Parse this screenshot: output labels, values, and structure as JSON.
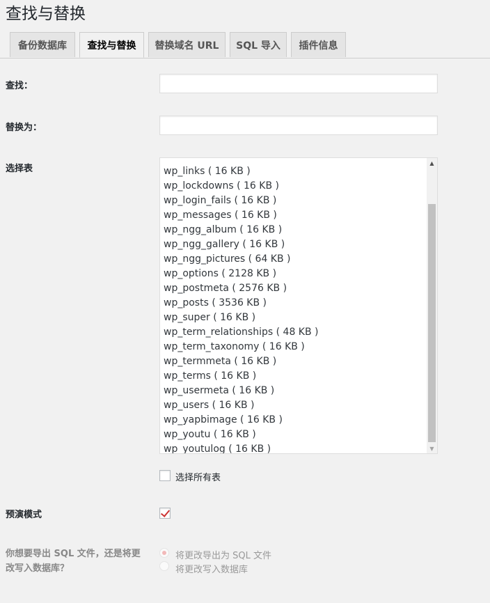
{
  "page": {
    "title": "查找与替换"
  },
  "tabs": [
    {
      "label": "备份数据库"
    },
    {
      "label": "查找与替换"
    },
    {
      "label": "替换域名 URL"
    },
    {
      "label": "SQL 导入"
    },
    {
      "label": "插件信息"
    }
  ],
  "form": {
    "find_label": "查找：",
    "replace_label": "替换为：",
    "select_tables_label": "选择表",
    "tables": [
      "wp_links ( 16 KB )",
      "wp_lockdowns ( 16 KB )",
      "wp_login_fails ( 16 KB )",
      "wp_messages ( 16 KB )",
      "wp_ngg_album ( 16 KB )",
      "wp_ngg_gallery ( 16 KB )",
      "wp_ngg_pictures ( 64 KB )",
      "wp_options ( 2128 KB )",
      "wp_postmeta ( 2576 KB )",
      "wp_posts ( 3536 KB )",
      "wp_super ( 16 KB )",
      "wp_term_relationships ( 48 KB )",
      "wp_term_taxonomy ( 16 KB )",
      "wp_termmeta ( 16 KB )",
      "wp_terms ( 16 KB )",
      "wp_usermeta ( 16 KB )",
      "wp_users ( 16 KB )",
      "wp_yapbimage ( 16 KB )",
      "wp_youtu ( 16 KB )",
      "wp_youtulog ( 16 KB )"
    ],
    "select_all_label": "选择所有表",
    "select_all_checked": false,
    "dry_run_label": "预演模式",
    "dry_run_checked": true,
    "export_question": "你想要导出 SQL 文件，还是将更改写入数据库？",
    "export_options": [
      {
        "label": "将更改导出为 SQL 文件",
        "selected": true
      },
      {
        "label": "将更改写入数据库",
        "selected": false
      }
    ]
  },
  "colors": {
    "background": "#f1f1f1",
    "checkmark": "#cc3333",
    "tab_inactive": "#e5e5e5"
  }
}
